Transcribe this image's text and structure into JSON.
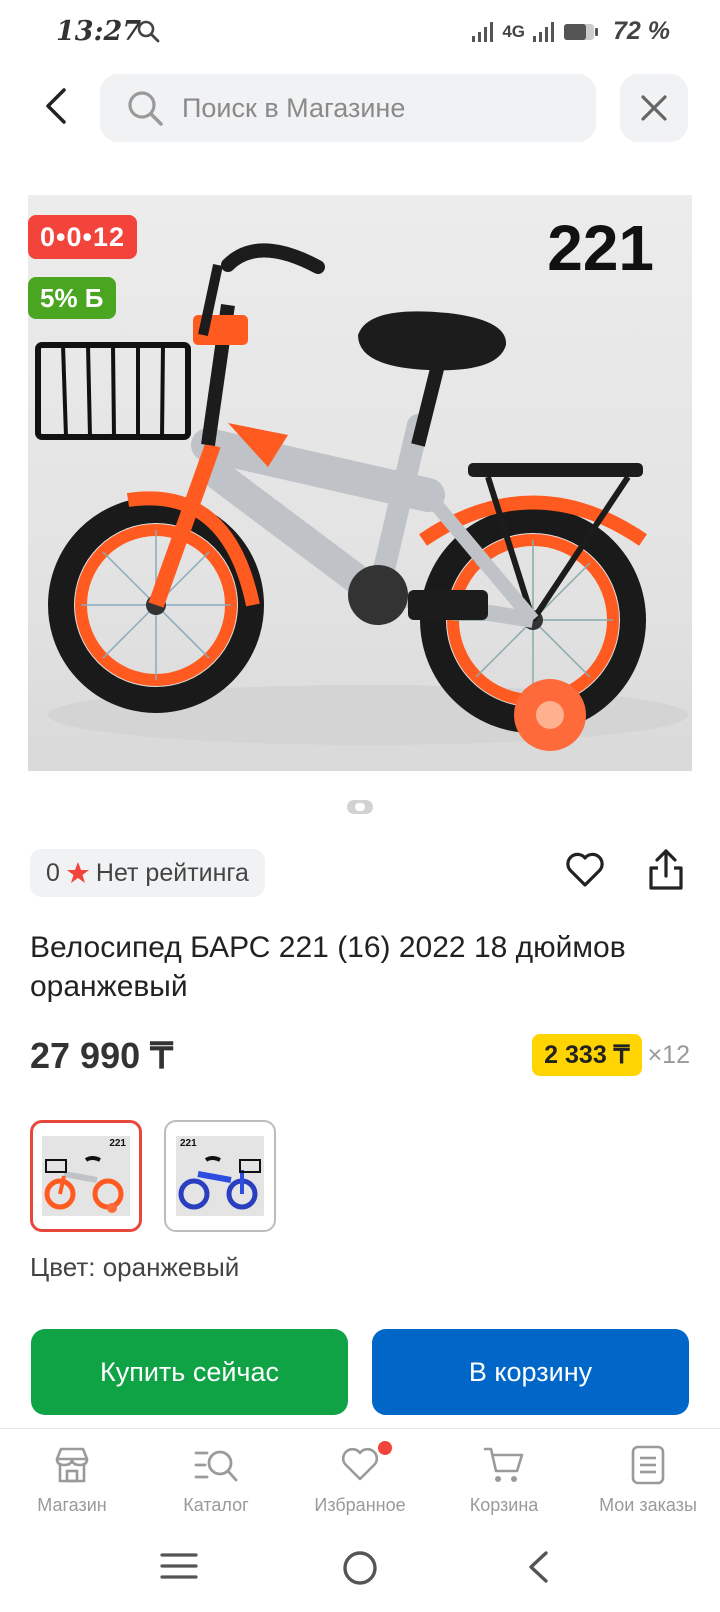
{
  "status": {
    "time": "13:27",
    "network": "4G",
    "battery": "72 %"
  },
  "search": {
    "placeholder": "Поиск в Магазине"
  },
  "product": {
    "badge_installment": "0•0•12",
    "badge_bonus": "5% Б",
    "model_number": "221",
    "rating_value": "0",
    "rating_text": "Нет рейтинга",
    "title": "Велосипед БАРС 221 (16) 2022 18 дюймов оранжевый",
    "price": "27 990 ₸",
    "installment_amount": "2 333 ₸",
    "installment_multiplier": "×12",
    "variants": [
      {
        "label": "221",
        "color": "orange"
      },
      {
        "label": "221",
        "color": "blue"
      }
    ],
    "color_label": "Цвет: оранжевый"
  },
  "actions": {
    "buy_now": "Купить сейчас",
    "add_to_cart": "В корзину"
  },
  "tabbar": {
    "items": [
      {
        "label": "Магазин",
        "icon": "store-icon"
      },
      {
        "label": "Каталог",
        "icon": "catalog-icon"
      },
      {
        "label": "Избранное",
        "icon": "heart-icon"
      },
      {
        "label": "Корзина",
        "icon": "cart-icon"
      },
      {
        "label": "Мои заказы",
        "icon": "orders-icon"
      }
    ]
  },
  "colors": {
    "badge_red": "#f2443b",
    "badge_green": "#4aa521",
    "installment_yellow": "#ffd400",
    "buy_green": "#0fa346",
    "cart_blue": "#0067c9",
    "bike_orange": "#ff5a1f"
  }
}
